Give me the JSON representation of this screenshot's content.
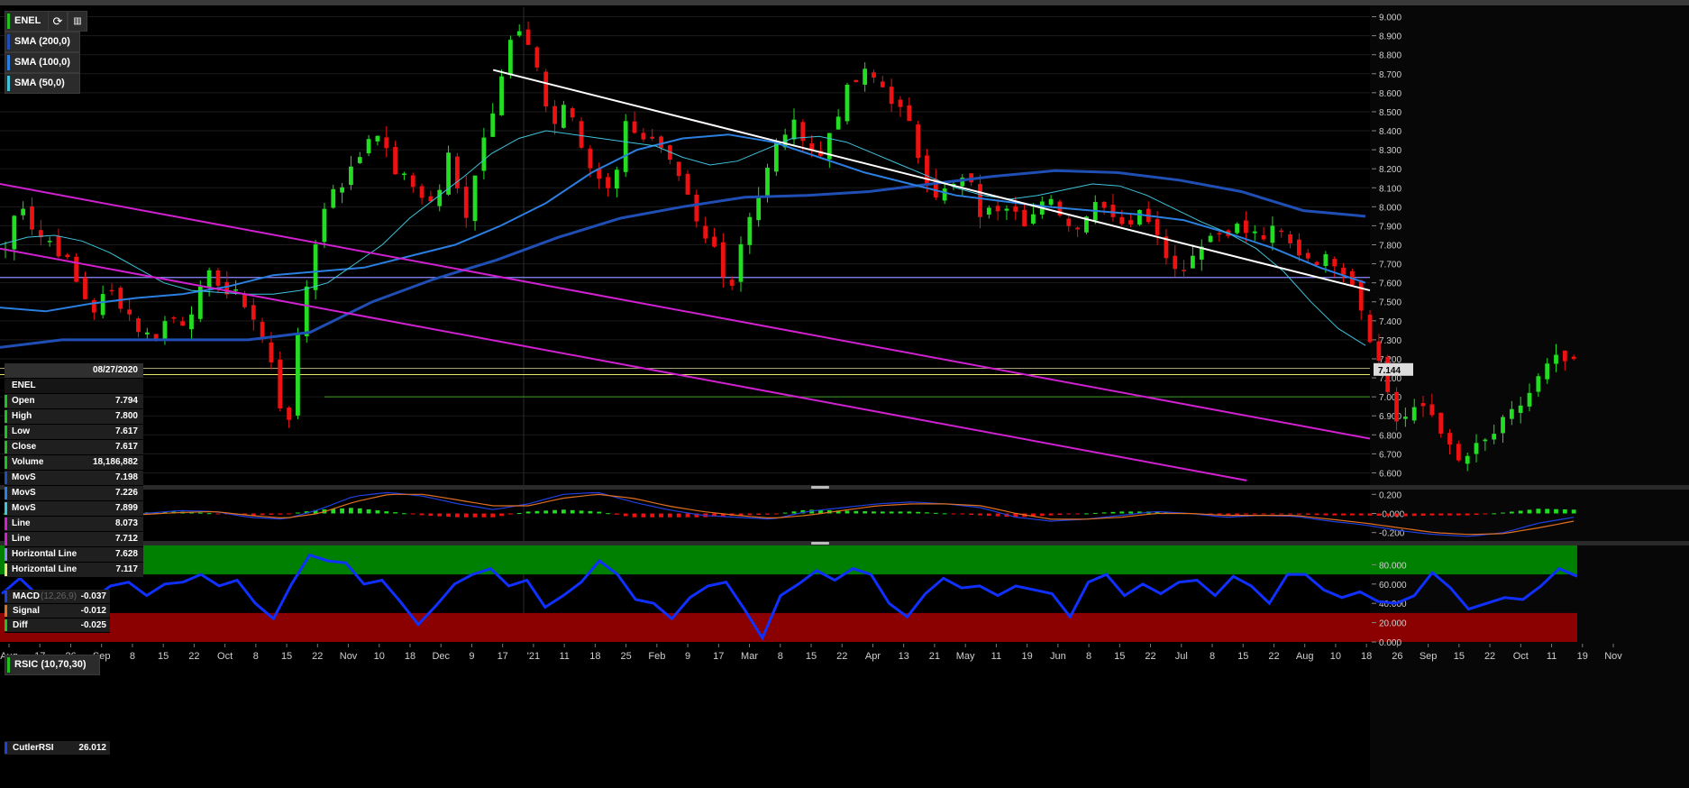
{
  "symbol_label": "ENEL",
  "legend": [
    {
      "label": "SMA (200,0)",
      "color": "#1f4fb4"
    },
    {
      "label": "SMA (100,0)",
      "color": "#2a7fe0"
    },
    {
      "label": "SMA (50,0)",
      "color": "#3fc4dc"
    }
  ],
  "icons": {
    "refresh": "refresh-icon",
    "chart": "chart-icon"
  },
  "data_window": {
    "date": "08/27/2020",
    "title": "ENEL",
    "rows": [
      {
        "k": "Open",
        "v": "7.794",
        "c": "#20c020"
      },
      {
        "k": "High",
        "v": "7.800",
        "c": "#20c020"
      },
      {
        "k": "Low",
        "v": "7.617",
        "c": "#20c020"
      },
      {
        "k": "Close",
        "v": "7.617",
        "c": "#20c020"
      },
      {
        "k": "Volume",
        "v": "18,186,882",
        "c": "#20c020"
      },
      {
        "k": "MovS",
        "v": "7.198",
        "c": "#1f4fb4"
      },
      {
        "k": "MovS",
        "v": "7.226",
        "c": "#2a7fe0"
      },
      {
        "k": "MovS",
        "v": "7.899",
        "c": "#3fc4dc"
      },
      {
        "k": "Line",
        "v": "8.073",
        "c": "#d020d0"
      },
      {
        "k": "Line",
        "v": "7.712",
        "c": "#d020d0"
      },
      {
        "k": "Horizontal Line",
        "v": "7.628",
        "c": "#8a8aff"
      },
      {
        "k": "Horizontal Line",
        "v": "7.117",
        "c": "#e8e86a"
      }
    ]
  },
  "macd_window": {
    "rows": [
      {
        "k": "MACD",
        "v": "-0.037",
        "c": "#2040e0"
      },
      {
        "k": "Signal",
        "v": "-0.012",
        "c": "#e07020"
      },
      {
        "k": "Diff",
        "v": "-0.025",
        "c": "#20c020"
      }
    ],
    "params": "(12,26,9)"
  },
  "rsi_label": "RSIC (10,70,30)",
  "rsi_window": {
    "k": "CutlerRSI",
    "v": "26.012"
  },
  "colors": {
    "up": "#22dd22",
    "down": "#ee1111",
    "sma200": "#1f4fb4",
    "sma100": "#2a7fe0",
    "sma50": "#3fc4dc",
    "trend_white": "#ffffff",
    "trend_magenta": "#d020d0",
    "hline_blue": "#8a8aff",
    "hline_yellow": "#e8e86a",
    "hline_green": "#3aa020",
    "rsi_line": "#1030ff",
    "rsi_upper": "#008000",
    "rsi_lower": "#8b0000"
  },
  "chart_data": [
    {
      "type": "candlestick",
      "series_name": "ENEL",
      "x_ticks": [
        "Aug",
        "17",
        "26",
        "Sep",
        "8",
        "15",
        "22",
        "Oct",
        "8",
        "15",
        "22",
        "Nov",
        "10",
        "18",
        "Dec",
        "9",
        "17",
        "'21",
        "11",
        "18",
        "25",
        "Feb",
        "9",
        "17",
        "Mar",
        "8",
        "15",
        "22",
        "Apr",
        "13",
        "21",
        "May",
        "11",
        "19",
        "Jun",
        "8",
        "15",
        "22",
        "Jul",
        "8",
        "15",
        "22",
        "Aug",
        "10",
        "18",
        "26",
        "Sep",
        "15",
        "22",
        "Oct",
        "11",
        "19",
        "Nov"
      ],
      "y_ticks": [
        "9.000",
        "8.900",
        "8.800",
        "8.700",
        "8.600",
        "8.500",
        "8.400",
        "8.300",
        "8.200",
        "8.100",
        "8.000",
        "7.900",
        "7.800",
        "7.700",
        "7.600",
        "7.500",
        "7.400",
        "7.300",
        "7.200",
        "7.100",
        "7.000",
        "6.900",
        "6.800",
        "6.700",
        "6.600"
      ],
      "ylim": [
        6.55,
        9.05
      ],
      "last_price": "7.144",
      "horizontal_lines": [
        {
          "y": 7.628,
          "name": "Horizontal Line"
        },
        {
          "y": 7.117,
          "name": "Horizontal Line"
        },
        {
          "y": 7.15
        },
        {
          "y": 7.0
        }
      ],
      "trend_lines": [
        {
          "name": "white",
          "from": {
            "t": 0.36,
            "y": 8.72
          },
          "to": {
            "t": 1.0,
            "y": 7.56
          }
        },
        {
          "name": "magenta-upper",
          "from": {
            "t": 0.0,
            "y": 8.12
          },
          "to": {
            "t": 1.0,
            "y": 6.78
          }
        },
        {
          "name": "magenta-lower",
          "from": {
            "t": 0.0,
            "y": 7.78
          },
          "to": {
            "t": 0.91,
            "y": 6.56
          }
        }
      ],
      "close_path": [
        7.78,
        8.06,
        7.86,
        7.82,
        7.74,
        7.56,
        7.46,
        7.56,
        7.48,
        7.36,
        7.3,
        7.42,
        7.4,
        7.52,
        7.66,
        7.54,
        7.52,
        7.38,
        7.16,
        6.8,
        7.44,
        7.84,
        8.1,
        8.14,
        8.28,
        8.44,
        8.22,
        8.14,
        8.08,
        8.0,
        8.28,
        7.92,
        8.28,
        8.54,
        8.88,
        8.92,
        8.68,
        8.42,
        8.58,
        8.26,
        8.16,
        8.1,
        8.46,
        8.38,
        8.32,
        8.2,
        8.06,
        7.84,
        7.78,
        7.56,
        7.92,
        8.08,
        8.3,
        8.44,
        8.38,
        8.24,
        8.46,
        8.62,
        8.7,
        8.66,
        8.56,
        8.44,
        8.2,
        8.06,
        8.1,
        8.16,
        7.94,
        8.0,
        8.04,
        7.92,
        8.0,
        8.02,
        7.88,
        7.96,
        8.06,
        7.94,
        7.92,
        7.98,
        7.86,
        7.66,
        7.72,
        7.84,
        7.86,
        7.9,
        7.86,
        7.84,
        7.88,
        7.78,
        7.74,
        7.72,
        7.72,
        7.62,
        7.38,
        7.14,
        6.88,
        6.9,
        6.96,
        6.84,
        6.64,
        6.7,
        6.76,
        6.84,
        6.92,
        7.02,
        7.14,
        7.2,
        7.16
      ],
      "sma50_path": [
        7.8,
        7.84,
        7.85,
        7.82,
        7.76,
        7.68,
        7.6,
        7.56,
        7.55,
        7.54,
        7.54,
        7.56,
        7.6,
        7.7,
        7.8,
        7.94,
        8.05,
        8.16,
        8.28,
        8.36,
        8.4,
        8.38,
        8.36,
        8.34,
        8.32,
        8.26,
        8.22,
        8.24,
        8.3,
        8.36,
        8.37,
        8.34,
        8.28,
        8.22,
        8.16,
        8.1,
        8.06,
        8.04,
        8.06,
        8.09,
        8.12,
        8.11,
        8.06,
        7.99,
        7.92,
        7.86,
        7.78,
        7.66,
        7.5,
        7.36,
        7.27
      ],
      "sma100_path": [
        7.47,
        7.45,
        7.49,
        7.52,
        7.54,
        7.58,
        7.64,
        7.66,
        7.68,
        7.74,
        7.8,
        7.9,
        8.02,
        8.18,
        8.3,
        8.36,
        8.38,
        8.34,
        8.26,
        8.18,
        8.12,
        8.06,
        8.03,
        8.0,
        7.98,
        7.96,
        7.93,
        7.86,
        7.78,
        7.68,
        7.6
      ],
      "sma200_path": [
        7.26,
        7.3,
        7.3,
        7.3,
        7.3,
        7.34,
        7.5,
        7.62,
        7.72,
        7.84,
        7.94,
        8.0,
        8.05,
        8.06,
        8.08,
        8.12,
        8.16,
        8.19,
        8.18,
        8.14,
        8.08,
        7.98,
        7.95
      ]
    },
    {
      "type": "bar",
      "series_name": "MACD",
      "y_ticks": [
        "0.200",
        "-0.000",
        "-0.200"
      ],
      "ylim": [
        -0.25,
        0.25
      ],
      "macd_path": [
        0.0,
        -0.02,
        -0.03,
        -0.02,
        0.0,
        0.03,
        0.02,
        -0.04,
        -0.06,
        0.04,
        0.18,
        0.22,
        0.18,
        0.1,
        0.04,
        0.1,
        0.2,
        0.22,
        0.12,
        0.04,
        -0.02,
        -0.04,
        -0.06,
        0.02,
        0.06,
        0.1,
        0.12,
        0.1,
        0.06,
        -0.04,
        -0.08,
        -0.06,
        -0.02,
        0.02,
        0.0,
        -0.04,
        -0.02,
        -0.03,
        -0.08,
        -0.12,
        -0.18,
        -0.22,
        -0.24,
        -0.2,
        -0.1,
        -0.04
      ],
      "signal_path": [
        0.0,
        -0.01,
        -0.02,
        -0.02,
        -0.01,
        0.01,
        0.02,
        -0.02,
        -0.05,
        0.0,
        0.12,
        0.2,
        0.2,
        0.14,
        0.08,
        0.08,
        0.16,
        0.2,
        0.16,
        0.08,
        0.02,
        -0.02,
        -0.05,
        -0.02,
        0.03,
        0.08,
        0.1,
        0.1,
        0.08,
        0.0,
        -0.06,
        -0.06,
        -0.04,
        0.0,
        0.0,
        -0.02,
        -0.02,
        -0.02,
        -0.06,
        -0.1,
        -0.15,
        -0.2,
        -0.22,
        -0.21,
        -0.15,
        -0.08
      ]
    },
    {
      "type": "line",
      "series_name": "RSIC (10,70,30)",
      "y_ticks": [
        "80.000",
        "60.000",
        "40.000",
        "20.000",
        "0.000"
      ],
      "ylim": [
        0,
        100
      ],
      "bands": {
        "upper": 70,
        "lower": 30
      },
      "rsi_path": [
        50,
        66,
        48,
        38,
        50,
        44,
        58,
        62,
        48,
        60,
        62,
        70,
        58,
        64,
        40,
        24,
        60,
        90,
        84,
        82,
        60,
        64,
        42,
        18,
        38,
        60,
        70,
        76,
        58,
        64,
        36,
        48,
        62,
        84,
        70,
        44,
        40,
        24,
        46,
        58,
        62,
        34,
        4,
        48,
        60,
        74,
        64,
        76,
        70,
        40,
        26,
        50,
        66,
        56,
        58,
        48,
        58,
        54,
        50,
        26,
        62,
        70,
        48,
        60,
        50,
        62,
        64,
        48,
        68,
        58,
        40,
        70,
        70,
        54,
        46,
        52,
        42,
        40,
        48,
        72,
        56,
        34,
        40,
        46,
        44,
        58,
        76,
        68
      ]
    }
  ]
}
